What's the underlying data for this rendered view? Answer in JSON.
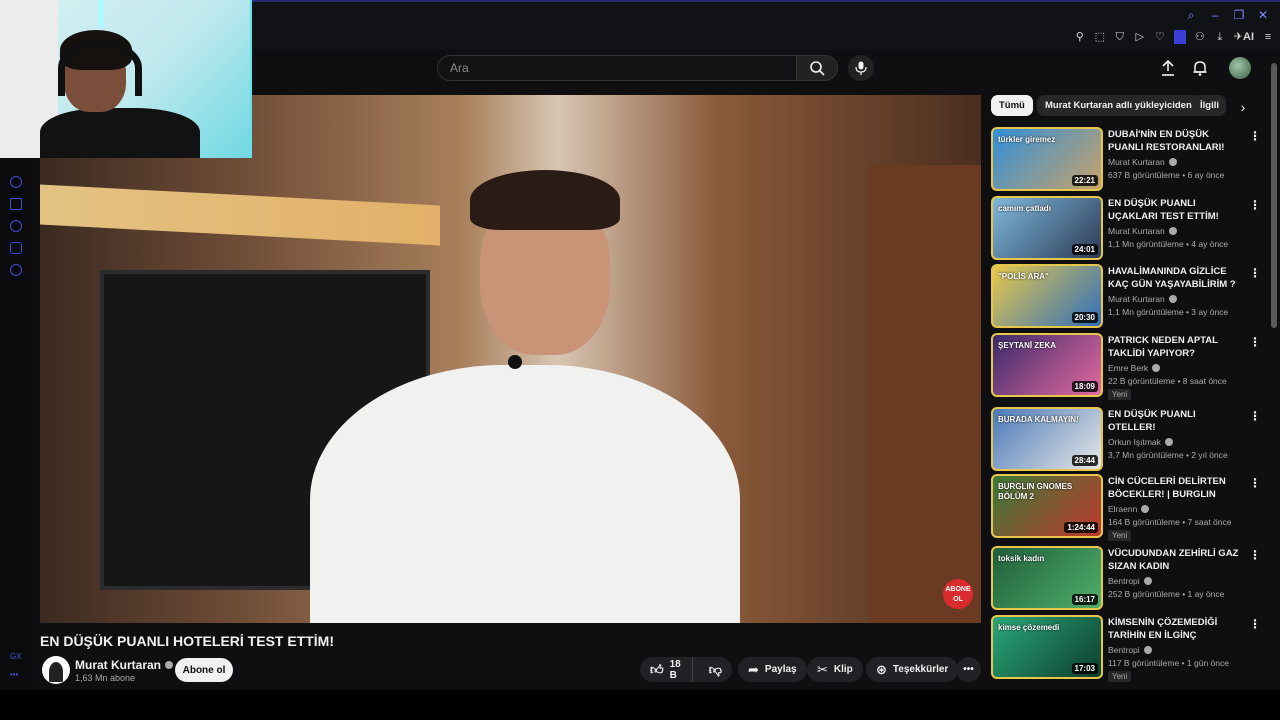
{
  "search": {
    "placeholder": "Ara"
  },
  "video": {
    "title": "EN DÜŞÜK PUANLI HOTELERİ TEST ETTİM!",
    "overlay_badge": "ABONE OL"
  },
  "channel": {
    "name": "Murat Kurtaran",
    "subscribers": "1,63 Mn abone",
    "subscribe_label": "Abone ol"
  },
  "actions": {
    "likes": "18 B",
    "share": "Paylaş",
    "clip": "Klip",
    "thanks": "Teşekkürler"
  },
  "sidebar_opera": {
    "label": "GX"
  },
  "chips": [
    "Tümü",
    "Murat Kurtaran adlı yükleyiciden",
    "İlgili"
  ],
  "recommendations": [
    {
      "title": "DUBAİ'NİN EN DÜŞÜK PUANLI RESTORANLARI!",
      "channel": "Murat Kurtaran",
      "meta": "637 B görüntüleme • 6 ay önce",
      "duration": "22:21",
      "badge": "",
      "thumb_text": "türkler giremez",
      "colors": [
        "#2f8fd8",
        "#c9a36b"
      ]
    },
    {
      "title": "EN DÜŞÜK PUANLI UÇAKLARI TEST ETTİM!",
      "channel": "Murat Kurtaran",
      "meta": "1,1 Mn görüntüleme • 4 ay önce",
      "duration": "24:01",
      "badge": "",
      "thumb_text": "camım çatladı",
      "colors": [
        "#7fb9dc",
        "#2b3a55"
      ]
    },
    {
      "title": "HAVALİMANINDA GİZLİCE KAÇ GÜN YAŞAYABİLİRİM ?",
      "channel": "Murat Kurtaran",
      "meta": "1,1 Mn görüntüleme • 3 ay önce",
      "duration": "20:30",
      "badge": "",
      "thumb_text": "\"POLİS ARA\"",
      "colors": [
        "#e8c94a",
        "#2e6ebd"
      ]
    },
    {
      "title": "PATRICK NEDEN APTAL TAKLİDİ YAPIYOR?",
      "channel": "Emre Berk",
      "meta": "22 B görüntüleme • 8 saat önce",
      "duration": "18:09",
      "badge": "Yeni",
      "thumb_text": "ŞEYTANİ ZEKA",
      "colors": [
        "#3a2a6a",
        "#e56aa0"
      ]
    },
    {
      "title": "EN DÜŞÜK PUANLI OTELLER!",
      "channel": "Orkun Işıtmak",
      "meta": "3,7 Mn görüntüleme • 2 yıl önce",
      "duration": "28:44",
      "badge": "",
      "thumb_text": "BURADA KALMAYIN!",
      "colors": [
        "#4a79b8",
        "#e8e8e8"
      ]
    },
    {
      "title": "CİN CÜCELERİ DELİRTEN BÖCEKLER! | BURGLIN GNOMES",
      "channel": "Elraenn",
      "meta": "164 B görüntüleme • 7 saat önce",
      "duration": "1:24:44",
      "badge": "Yeni",
      "thumb_text": "BURGLIN GNOMES BÖLÜM 2",
      "colors": [
        "#3a7a3a",
        "#c0392b"
      ]
    },
    {
      "title": "VÜCUDUNDAN ZEHİRLİ GAZ SIZAN KADIN",
      "channel": "Bentropi",
      "meta": "252 B görüntüleme • 1 ay önce",
      "duration": "16:17",
      "badge": "",
      "thumb_text": "toksik kadın",
      "colors": [
        "#1f5e3a",
        "#4fb06b"
      ]
    },
    {
      "title": "KİMSENİN ÇÖZEMEDİĞİ TARİHİN EN İLGİNÇ KAYBOLMASI",
      "channel": "Bentropi",
      "meta": "117 B görüntüleme • 1 gün önce",
      "duration": "17:03",
      "badge": "Yeni",
      "thumb_text": "kimse çözemedi",
      "colors": [
        "#2aa87a",
        "#0d3d2b"
      ]
    }
  ],
  "colors": {
    "accent": "#3f4bd1",
    "background": "#0f0f12",
    "thumb_border": "#e7c74b"
  }
}
